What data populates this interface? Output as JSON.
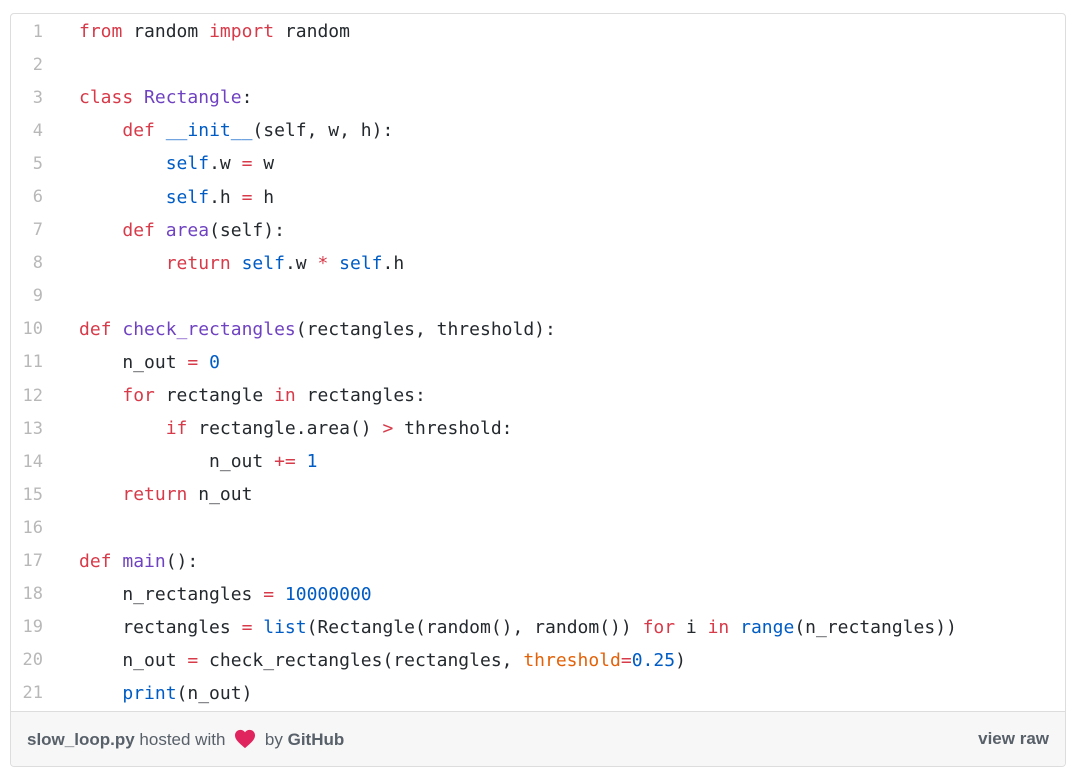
{
  "file": {
    "filename": "slow_loop.py",
    "hosted_text": "hosted with",
    "by_text": "by",
    "host_name": "GitHub",
    "view_raw_label": "view raw"
  },
  "colors": {
    "keyword": "#d73a49",
    "function": "#6f42c1",
    "builtin": "#005cc5",
    "param": "#e36209",
    "heart": "#e0245e"
  },
  "lines": [
    {
      "n": "1",
      "tokens": [
        [
          "kw",
          "from"
        ],
        [
          "",
          "random"
        ],
        [
          "kw",
          "import"
        ],
        [
          "",
          "random"
        ]
      ],
      "raw": ""
    },
    {
      "n": "2",
      "tokens": []
    },
    {
      "n": "3",
      "tokens": []
    },
    {
      "n": "4",
      "tokens": []
    },
    {
      "n": "5",
      "tokens": []
    },
    {
      "n": "6",
      "tokens": []
    },
    {
      "n": "7",
      "tokens": []
    },
    {
      "n": "8",
      "tokens": []
    },
    {
      "n": "9",
      "tokens": []
    },
    {
      "n": "10",
      "tokens": []
    },
    {
      "n": "11",
      "tokens": []
    },
    {
      "n": "12",
      "tokens": []
    },
    {
      "n": "13",
      "tokens": []
    },
    {
      "n": "14",
      "tokens": []
    },
    {
      "n": "15",
      "tokens": []
    },
    {
      "n": "16",
      "tokens": []
    },
    {
      "n": "17",
      "tokens": []
    },
    {
      "n": "18",
      "tokens": []
    },
    {
      "n": "19",
      "tokens": []
    },
    {
      "n": "20",
      "tokens": []
    },
    {
      "n": "21",
      "tokens": []
    }
  ],
  "code": [
    [
      [
        "kw",
        "from"
      ],
      [
        "",
        " random "
      ],
      [
        "kw",
        "import"
      ],
      [
        "",
        " random"
      ]
    ],
    [],
    [
      [
        "kw",
        "class"
      ],
      [
        "",
        " "
      ],
      [
        "fn",
        "Rectangle"
      ],
      [
        "",
        ":"
      ]
    ],
    [
      [
        "",
        "    "
      ],
      [
        "kw",
        "def"
      ],
      [
        "",
        " "
      ],
      [
        "bi",
        "__init__"
      ],
      [
        "",
        "(self, w, h):"
      ]
    ],
    [
      [
        "",
        "        "
      ],
      [
        "bi",
        "self"
      ],
      [
        "",
        ".w "
      ],
      [
        "kw",
        "="
      ],
      [
        "",
        " w"
      ]
    ],
    [
      [
        "",
        "        "
      ],
      [
        "bi",
        "self"
      ],
      [
        "",
        ".h "
      ],
      [
        "kw",
        "="
      ],
      [
        "",
        " h"
      ]
    ],
    [
      [
        "",
        "    "
      ],
      [
        "kw",
        "def"
      ],
      [
        "",
        " "
      ],
      [
        "fn",
        "area"
      ],
      [
        "",
        "(self):"
      ]
    ],
    [
      [
        "",
        "        "
      ],
      [
        "kw",
        "return"
      ],
      [
        "",
        " "
      ],
      [
        "bi",
        "self"
      ],
      [
        "",
        ".w "
      ],
      [
        "kw",
        "*"
      ],
      [
        "",
        " "
      ],
      [
        "bi",
        "self"
      ],
      [
        "",
        ".h"
      ]
    ],
    [],
    [
      [
        "kw",
        "def"
      ],
      [
        "",
        " "
      ],
      [
        "fn",
        "check_rectangles"
      ],
      [
        "",
        "(rectangles, threshold):"
      ]
    ],
    [
      [
        "",
        "    n_out "
      ],
      [
        "kw",
        "="
      ],
      [
        "",
        " "
      ],
      [
        "num",
        "0"
      ]
    ],
    [
      [
        "",
        "    "
      ],
      [
        "kw",
        "for"
      ],
      [
        "",
        " rectangle "
      ],
      [
        "kw",
        "in"
      ],
      [
        "",
        " rectangles:"
      ]
    ],
    [
      [
        "",
        "        "
      ],
      [
        "kw",
        "if"
      ],
      [
        "",
        " rectangle.area() "
      ],
      [
        "kw",
        ">"
      ],
      [
        "",
        " threshold:"
      ]
    ],
    [
      [
        "",
        "            n_out "
      ],
      [
        "kw",
        "+="
      ],
      [
        "",
        " "
      ],
      [
        "num",
        "1"
      ]
    ],
    [
      [
        "",
        "    "
      ],
      [
        "kw",
        "return"
      ],
      [
        "",
        " n_out"
      ]
    ],
    [],
    [
      [
        "kw",
        "def"
      ],
      [
        "",
        " "
      ],
      [
        "fn",
        "main"
      ],
      [
        "",
        "():"
      ]
    ],
    [
      [
        "",
        "    n_rectangles "
      ],
      [
        "kw",
        "="
      ],
      [
        "",
        " "
      ],
      [
        "num",
        "10000000"
      ]
    ],
    [
      [
        "",
        "    rectangles "
      ],
      [
        "kw",
        "="
      ],
      [
        "",
        " "
      ],
      [
        "bi",
        "list"
      ],
      [
        "",
        "(Rectangle(random(), random()) "
      ],
      [
        "kw",
        "for"
      ],
      [
        "",
        " i "
      ],
      [
        "kw",
        "in"
      ],
      [
        "",
        " "
      ],
      [
        "bi",
        "range"
      ],
      [
        "",
        "(n_rectangles))"
      ]
    ],
    [
      [
        "",
        "    n_out "
      ],
      [
        "kw",
        "="
      ],
      [
        "",
        " check_rectangles(rectangles, "
      ],
      [
        "param",
        "threshold"
      ],
      [
        "kw",
        "="
      ],
      [
        "num",
        "0.25"
      ],
      [
        "",
        ")"
      ]
    ],
    [
      [
        "",
        "    "
      ],
      [
        "bi",
        "print"
      ],
      [
        "",
        "(n_out)"
      ]
    ]
  ]
}
